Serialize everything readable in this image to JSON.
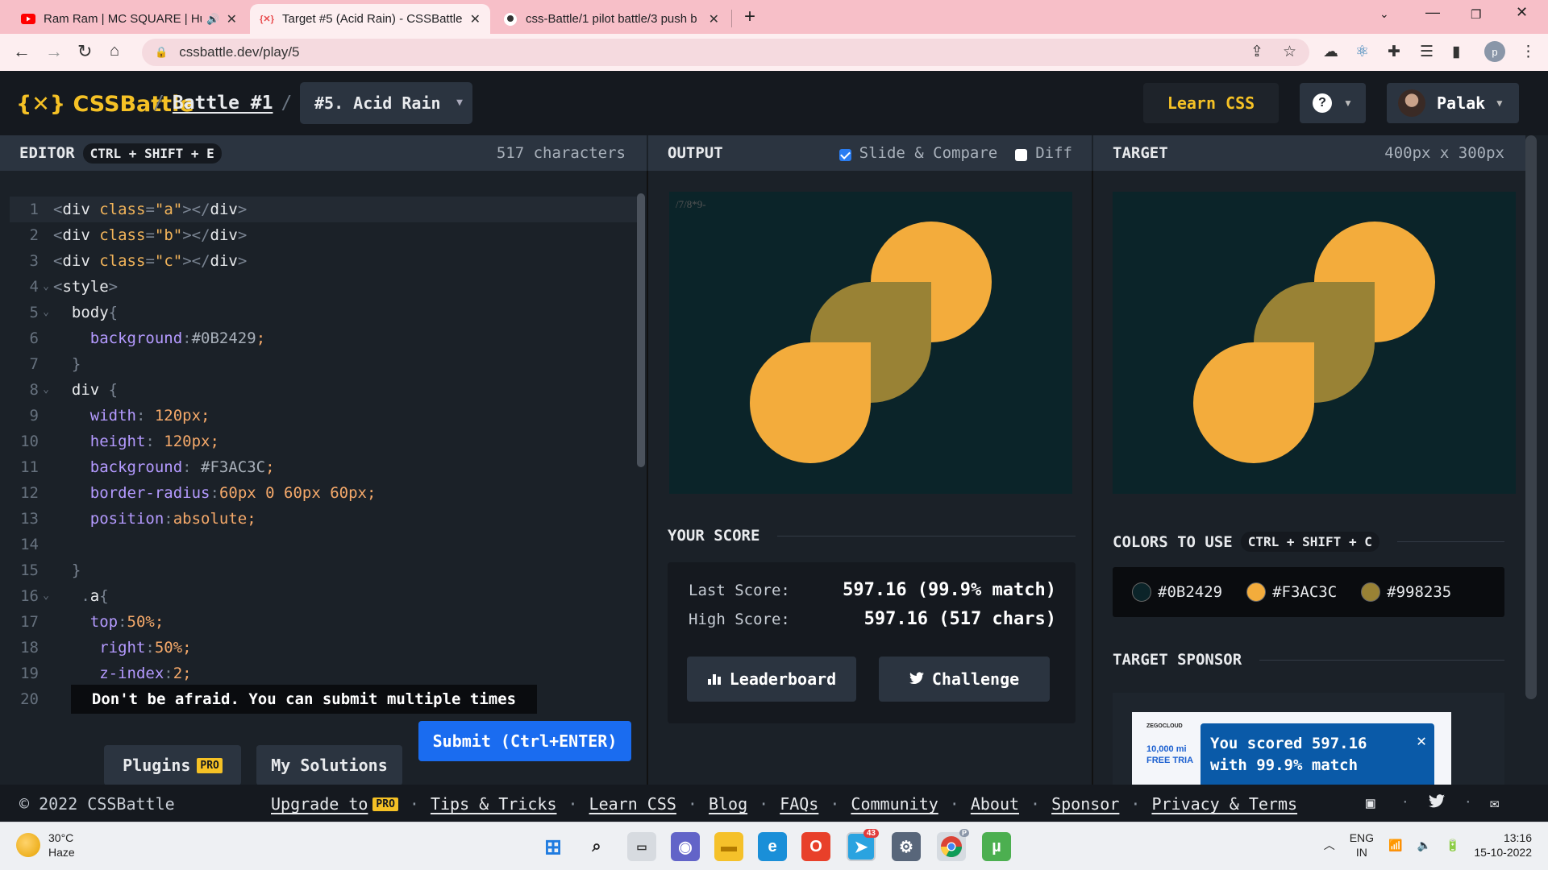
{
  "browser": {
    "tabs": [
      {
        "title": "Ram Ram | MC SQUARE | Hu",
        "icon": "youtube-icon"
      },
      {
        "title": "Target #5 (Acid Rain) - CSSBattle",
        "icon": "cssbattle-icon",
        "active": true
      },
      {
        "title": "css-Battle/1 pilot battle/3 push b",
        "icon": "github-icon"
      }
    ],
    "url": "cssbattle.dev/play/5",
    "profile_initial": "p"
  },
  "header": {
    "logo": "{✕} CSSBattle",
    "crumb_sep": "/",
    "battle_link": "Battle #1",
    "target_select": "#5. Acid Rain",
    "learn_css": "Learn CSS",
    "help": "?",
    "user_name": "Palak"
  },
  "editor": {
    "title": "EDITOR",
    "shortcut": "CTRL + SHIFT + E",
    "char_count": "517 characters",
    "tooltip": "Don't be afraid. You can submit multiple times",
    "plugins_label": "Plugins",
    "pro_badge": "PRO",
    "my_solutions_label": "My Solutions",
    "submit_label": "Submit (Ctrl+ENTER)",
    "lines": [
      {
        "n": "1",
        "fold": "",
        "html": "<span class='t-p'>&lt;</span><span class='t-tag'>div</span> <span class='t-attr'>class</span><span class='t-p'>=</span><span class='t-str'>\"a\"</span><span class='t-p'>&gt;&lt;/</span><span class='t-tag'>div</span><span class='t-p'>&gt;</span>"
      },
      {
        "n": "2",
        "fold": "",
        "html": "<span class='t-p'>&lt;</span><span class='t-tag'>div</span> <span class='t-attr'>class</span><span class='t-p'>=</span><span class='t-str'>\"b\"</span><span class='t-p'>&gt;&lt;/</span><span class='t-tag'>div</span><span class='t-p'>&gt;</span>"
      },
      {
        "n": "3",
        "fold": "",
        "html": "<span class='t-p'>&lt;</span><span class='t-tag'>div</span> <span class='t-attr'>class</span><span class='t-p'>=</span><span class='t-str'>\"c\"</span><span class='t-p'>&gt;&lt;/</span><span class='t-tag'>div</span><span class='t-p'>&gt;</span>"
      },
      {
        "n": "4",
        "fold": "⌄",
        "html": "<span class='t-p'>&lt;</span><span class='t-tag'>style</span><span class='t-p'>&gt;</span>"
      },
      {
        "n": "5",
        "fold": "⌄",
        "html": "  <span class='t-sel'>body</span><span class='t-p'>{</span>"
      },
      {
        "n": "6",
        "fold": "",
        "html": "    <span class='t-prop'>background</span><span class='t-p'>:</span><span class='t-col'>#0B2429</span><span class='t-num'>;</span>"
      },
      {
        "n": "7",
        "fold": "",
        "html": "  <span class='t-p'>}</span>"
      },
      {
        "n": "8",
        "fold": "⌄",
        "html": "  <span class='t-sel'>div</span> <span class='t-p'>{</span>"
      },
      {
        "n": "9",
        "fold": "",
        "html": "    <span class='t-prop'>width</span><span class='t-p'>: </span><span class='t-num'>120px;</span>"
      },
      {
        "n": "10",
        "fold": "",
        "html": "    <span class='t-prop'>height</span><span class='t-p'>: </span><span class='t-num'>120px;</span>"
      },
      {
        "n": "11",
        "fold": "",
        "html": "    <span class='t-prop'>background</span><span class='t-p'>: </span><span class='t-col'>#F3AC3C</span><span class='t-num'>;</span>"
      },
      {
        "n": "12",
        "fold": "",
        "html": "    <span class='t-prop'>border-radius</span><span class='t-p'>:</span><span class='t-num'>60px 0 60px 60px;</span>"
      },
      {
        "n": "13",
        "fold": "",
        "html": "    <span class='t-prop'>position</span><span class='t-p'>:</span><span class='t-num'>absolute;</span>"
      },
      {
        "n": "14",
        "fold": "",
        "html": ""
      },
      {
        "n": "15",
        "fold": "",
        "html": "  <span class='t-p'>}</span>"
      },
      {
        "n": "16",
        "fold": "⌄",
        "html": "   <span class='t-p'>.</span><span class='t-sel'>a</span><span class='t-p'>{</span>"
      },
      {
        "n": "17",
        "fold": "",
        "html": "    <span class='t-prop'>top</span><span class='t-p'>:</span><span class='t-num'>50%;</span>"
      },
      {
        "n": "18",
        "fold": "",
        "html": "     <span class='t-prop'>right</span><span class='t-p'>:</span><span class='t-num'>50%;</span>"
      },
      {
        "n": "19",
        "fold": "",
        "html": "     <span class='t-prop'>z-index</span><span class='t-p'>:</span><span class='t-num'>2;</span>"
      },
      {
        "n": "20",
        "fold": "",
        "html": ""
      }
    ]
  },
  "output": {
    "title": "OUTPUT",
    "slide_compare": "Slide & Compare",
    "diff": "Diff",
    "stray_text": "/7/8*9-",
    "score_title": "YOUR SCORE",
    "last_score_label": "Last Score:",
    "last_score_value": "597.16 (99.9% match)",
    "high_score_label": "High Score:",
    "high_score_value": "597.16 (517 chars)",
    "leaderboard_label": "Leaderboard",
    "challenge_label": "Challenge"
  },
  "target": {
    "title": "TARGET",
    "size": "400px x 300px",
    "colors_title": "COLORS TO USE",
    "colors_shortcut": "CTRL + SHIFT + C",
    "colors": [
      {
        "hex": "#0B2429",
        "label": "#0B2429"
      },
      {
        "hex": "#F3AC3C",
        "label": "#F3AC3C"
      },
      {
        "hex": "#998235",
        "label": "#998235"
      }
    ],
    "sponsor_title": "TARGET SPONSOR",
    "sponsor_brand": "ZEGOCLOUD",
    "sponsor_line1": "10,000 mi",
    "sponsor_line2": "FREE TRIA"
  },
  "toast": {
    "message": "You scored 597.16 with 99.9% match",
    "close": "✕",
    "progress": 0.8
  },
  "footer": {
    "copyright": "© 2022 CSSBattle",
    "links": [
      "Upgrade to",
      "Tips & Tricks",
      "Learn CSS",
      "Blog",
      "FAQs",
      "Community",
      "About",
      "Sponsor",
      "Privacy & Terms"
    ],
    "sep": "·"
  },
  "taskbar": {
    "temp": "30°C",
    "condition": "Haze",
    "telegram_badge": "43",
    "chrome_badge": "P",
    "lang1": "ENG",
    "lang2": "IN",
    "time": "13:16",
    "date": "15-10-2022"
  },
  "colors": {
    "accent_yellow": "#F5C125",
    "canvas_bg": "#0B2429",
    "drop_orange": "#F3AC3C",
    "drop_olive": "#998235",
    "submit_blue": "#1A6CF0"
  }
}
